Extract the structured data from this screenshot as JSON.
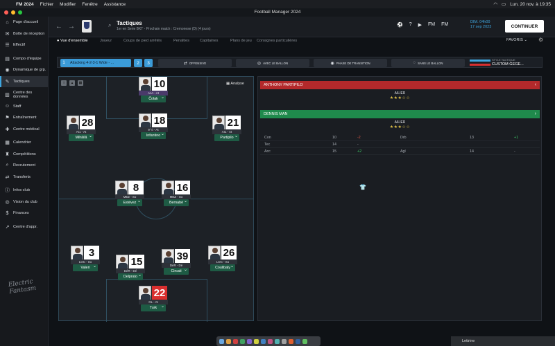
{
  "menubar": {
    "app": "FM 2024",
    "items": [
      "Fichier",
      "Modifier",
      "Fenêtre",
      "Assistance"
    ],
    "clock": "Lun. 20 nov. à 19:35"
  },
  "window": {
    "title": "Football Manager 2024"
  },
  "sidebar": {
    "items": [
      {
        "label": "Page d'accueil",
        "icon": "home-icon"
      },
      {
        "label": "Boîte de réception",
        "icon": "inbox-icon"
      },
      {
        "label": "Effectif",
        "icon": "squad-icon"
      },
      {
        "label": "Compo d'équipe",
        "icon": "lineup-icon"
      },
      {
        "label": "Dynamique de grp.",
        "icon": "dynamics-icon"
      },
      {
        "label": "Tactiques",
        "icon": "tactics-icon"
      },
      {
        "label": "Centre des données",
        "icon": "data-icon"
      },
      {
        "label": "Staff",
        "icon": "staff-icon"
      },
      {
        "label": "Entraînement",
        "icon": "training-icon"
      },
      {
        "label": "Centre médical",
        "icon": "medical-icon"
      },
      {
        "label": "Calendrier",
        "icon": "calendar-icon"
      },
      {
        "label": "Compétitions",
        "icon": "trophy-icon"
      },
      {
        "label": "Recrutement",
        "icon": "scouting-icon"
      },
      {
        "label": "Transferts",
        "icon": "transfer-icon"
      },
      {
        "label": "Infos club",
        "icon": "info-icon"
      },
      {
        "label": "Vision du club",
        "icon": "vision-icon"
      },
      {
        "label": "Finances",
        "icon": "finance-icon"
      },
      {
        "label": "Centre d'appr.",
        "icon": "development-icon"
      }
    ],
    "active_index": 5,
    "logo_text": "Electric Fantasm"
  },
  "header": {
    "title": "Tactiques",
    "subtitle": "1er en Serie BKT - Prochain match : Cremonese (D) (4 jours)",
    "date_line1": "DIM. 04h00",
    "date_line2": "17 sep 2023",
    "continue_label": "CONTINUER",
    "favoris_label": "FAVORIS"
  },
  "subtabs": [
    "Vue d'ensemble",
    "Joueur",
    "Coups de pied arrêtés",
    "Penalties",
    "Capitaines",
    "Plans de jeu",
    "Consignes particulières"
  ],
  "tactic_bar": {
    "slot1": "1",
    "formation": "Attacking 4-2-3-1 Wide - ...",
    "slot2": "2",
    "slot3": "3",
    "phases": [
      "OFFENSIVE",
      "AVEC LE BALLON",
      "PHASE DE TRANSITION",
      "SANS LE BALLON"
    ],
    "style_label": "STYLE TACTIQUE",
    "style_value": "CUSTOM GEGE..."
  },
  "pitch": {
    "analyse_label": "Analyse",
    "players": [
      {
        "num": "10",
        "role": "A1A - At",
        "name": "Čolak",
        "role_purple": true,
        "gk": false
      },
      {
        "num": "28",
        "role": "AI1 - At",
        "name": "Mihăilă",
        "role_purple": false,
        "gk": false
      },
      {
        "num": "18",
        "role": "9 ½ - At",
        "name": "Infantino",
        "role_purple": false,
        "gk": false
      },
      {
        "num": "21",
        "role": "AI1 - At",
        "name": "Partipilo",
        "role_purple": false,
        "gk": false
      },
      {
        "num": "8",
        "role": "MEZ - Sо",
        "name": "Estévez",
        "role_purple": false,
        "gk": false
      },
      {
        "num": "16",
        "role": "MEZ - Sо",
        "name": "Bernabé",
        "role_purple": false,
        "gk": false
      },
      {
        "num": "3",
        "role": "LOC - Sо",
        "name": "Valeri",
        "role_purple": false,
        "gk": false
      },
      {
        "num": "15",
        "role": "DéR - Dé",
        "name": "Delprato",
        "role_purple": false,
        "gk": false
      },
      {
        "num": "39",
        "role": "DéR - Dé",
        "name": "Circati",
        "role_purple": false,
        "gk": false
      },
      {
        "num": "26",
        "role": "LOC - Sо",
        "name": "Coulibaly",
        "role_purple": false,
        "gk": false
      },
      {
        "num": "22",
        "role": "GL - At",
        "name": "Turk",
        "role_purple": false,
        "gk": true
      }
    ]
  },
  "comparison": {
    "player1": {
      "name": "ANTHONY PARTIPILO",
      "position": "AILIER",
      "stars": "★★★☆☆",
      "color": "#b3292b"
    },
    "player2": {
      "name": "DENNIS MAN",
      "position": "AILIER",
      "stars": "★★★☆☆",
      "color": "#1f8a4c"
    },
    "attributes": [
      {
        "a": "Con",
        "av": "10",
        "ad": "-2",
        "b": "Drb",
        "bv": "13",
        "bd": "+1"
      },
      {
        "a": "Tec",
        "av": "14",
        "ad": "-",
        "b": "",
        "bv": "",
        "bd": ""
      },
      {
        "a": "Acc",
        "av": "15",
        "ad": "+2",
        "b": "Agl",
        "bv": "14",
        "bd": "-"
      }
    ]
  },
  "dock": {
    "stack_label": "Lettrine"
  }
}
